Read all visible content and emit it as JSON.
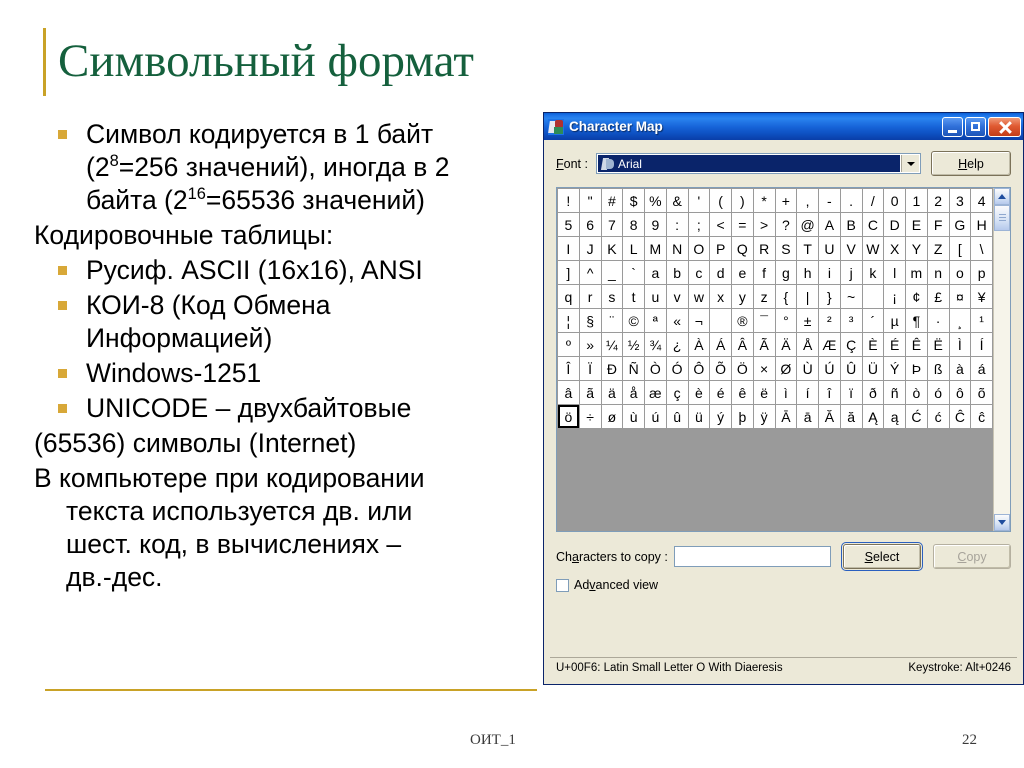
{
  "slide": {
    "title": "Символьный формат",
    "blocks": [
      {
        "kind": "bullet",
        "lines": [
          "Символ кодируется в 1 байт",
          "(2|8|=256 значений), иногда в 2",
          "байта (2|16|=65536 значений)"
        ]
      },
      {
        "kind": "plain",
        "lines": [
          "Кодировочные таблицы:"
        ]
      },
      {
        "kind": "bullet",
        "lines": [
          "Русиф. ASCII (16x16), ANSI"
        ]
      },
      {
        "kind": "bullet",
        "lines": [
          "КОИ-8 (Код Обмена",
          "Информацией)"
        ]
      },
      {
        "kind": "bullet",
        "lines": [
          "Windows-1251"
        ]
      },
      {
        "kind": "bullet",
        "lines": [
          "UNICODE – двухбайтовые"
        ]
      },
      {
        "kind": "plain",
        "lines": [
          " (65536) символы (Internet)"
        ]
      },
      {
        "kind": "para",
        "lines": [
          "В компьютере при кодировании",
          "текста используется дв. или",
          "шест. код, в вычислениях –",
          "дв.-дес."
        ]
      }
    ],
    "footer_left": "ОИТ_1",
    "footer_page": "22",
    "accent_gold": "#c9a227",
    "title_green": "#15603d",
    "bullet_gold": "#d8a838"
  },
  "charmap": {
    "window_title": "Character Map",
    "titlebar_buttons": {
      "minimize": "minimize",
      "maximize": "maximize",
      "close": "close"
    },
    "font_label": "Font :",
    "font_label_accesskey": "F",
    "font_value": "Arial",
    "help_label": "Help",
    "help_accesskey": "H",
    "copy_label": "Characters to copy :",
    "copy_label_accesskey": "a",
    "copy_input_value": "",
    "select_label": "Select",
    "select_accesskey": "S",
    "copy_button_label": "Copy",
    "copy_button_accesskey": "C",
    "advanced_view_label": "Advanced view",
    "advanced_view_accesskey": "v",
    "advanced_view_checked": false,
    "status_left": "U+00F6: Latin Small Letter O With Diaeresis",
    "status_right": "Keystroke: Alt+0246",
    "selected_index": 180,
    "grid_columns": 20,
    "grid": [
      "!",
      "\"",
      "#",
      "$",
      "%",
      "&",
      "'",
      "(",
      ")",
      "*",
      "+",
      ",",
      "-",
      ".",
      "/",
      "0",
      "1",
      "2",
      "3",
      "4",
      "5",
      "6",
      "7",
      "8",
      "9",
      ":",
      ";",
      "<",
      "=",
      ">",
      "?",
      "@",
      "A",
      "B",
      "C",
      "D",
      "E",
      "F",
      "G",
      "H",
      "I",
      "J",
      "K",
      "L",
      "M",
      "N",
      "O",
      "P",
      "Q",
      "R",
      "S",
      "T",
      "U",
      "V",
      "W",
      "X",
      "Y",
      "Z",
      "[",
      "\\",
      "]",
      "^",
      "_",
      "`",
      "a",
      "b",
      "c",
      "d",
      "e",
      "f",
      "g",
      "h",
      "i",
      "j",
      "k",
      "l",
      "m",
      "n",
      "o",
      "p",
      "q",
      "r",
      "s",
      "t",
      "u",
      "v",
      "w",
      "x",
      "y",
      "z",
      "{",
      "|",
      "}",
      "~",
      " ",
      "¡",
      "¢",
      "£",
      "¤",
      "¥",
      "¦",
      "§",
      "¨",
      "©",
      "ª",
      "«",
      "¬",
      "­",
      "®",
      "¯",
      "°",
      "±",
      "²",
      "³",
      "´",
      "µ",
      "¶",
      "·",
      "¸",
      "¹",
      "º",
      "»",
      "¼",
      "½",
      "¾",
      "¿",
      "À",
      "Á",
      "Â",
      "Ã",
      "Ä",
      "Å",
      "Æ",
      "Ç",
      "È",
      "É",
      "Ê",
      "Ë",
      "Ì",
      "Í",
      "Î",
      "Ï",
      "Ð",
      "Ñ",
      "Ò",
      "Ó",
      "Ô",
      "Õ",
      "Ö",
      "×",
      "Ø",
      "Ù",
      "Ú",
      "Û",
      "Ü",
      "Ý",
      "Þ",
      "ß",
      "à",
      "á",
      "â",
      "ã",
      "ä",
      "å",
      "æ",
      "ç",
      "è",
      "é",
      "ê",
      "ë",
      "ì",
      "í",
      "î",
      "ï",
      "ð",
      "ñ",
      "ò",
      "ó",
      "ô",
      "õ",
      "ö",
      "÷",
      "ø",
      "ù",
      "ú",
      "û",
      "ü",
      "ý",
      "þ",
      "ÿ",
      "Ā",
      "ā",
      "Ă",
      "ă",
      "Ą",
      "ą",
      "Ć",
      "ć",
      "Ĉ",
      "ĉ"
    ]
  }
}
